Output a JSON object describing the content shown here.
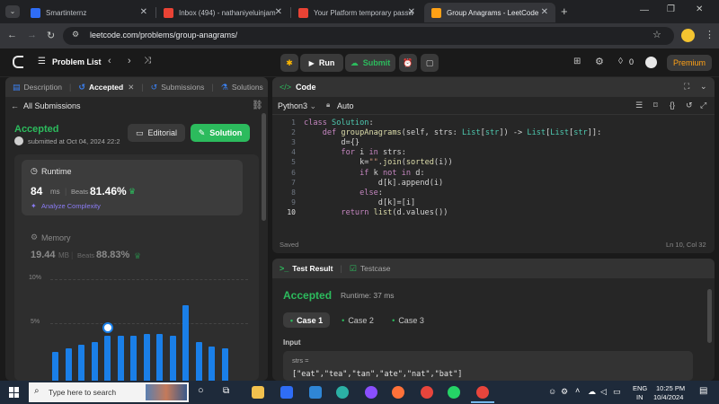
{
  "browser": {
    "tabs": [
      {
        "label": "Smartinternz",
        "fav": "#2f6df6"
      },
      {
        "label": "Inbox (494) - nathaniyeluinjam",
        "fav": "#ea4335"
      },
      {
        "label": "Your Platform temporary passw",
        "fav": "#ea4335"
      },
      {
        "label": "Group Anagrams - LeetCode",
        "fav": "#ffa116"
      }
    ],
    "new_tab": "+",
    "url": "leetcode.com/problems/group-anagrams/"
  },
  "lc": {
    "problem_list": "Problem List",
    "run": "Run",
    "submit": "Submit",
    "counter": "0",
    "premium": "Premium"
  },
  "left": {
    "tabs": [
      "Description",
      "Accepted",
      "Submissions",
      "Solutions"
    ],
    "all_submissions": "All Submissions",
    "status": "Accepted",
    "submitted": "submitted at Oct 04, 2024 22:2",
    "editorial": "Editorial",
    "solution": "Solution",
    "runtime": {
      "title": "Runtime",
      "value": "84",
      "unit": "ms",
      "beats_label": "Beats",
      "beats_value": "81.46%",
      "analyze": "Analyze Complexity"
    },
    "memory": {
      "title": "Memory",
      "value": "19.44",
      "unit": "MB",
      "beats_label": "Beats",
      "beats_value": "88.83%"
    },
    "chart_labels": {
      "top": "10%",
      "mid": "5%"
    }
  },
  "chart_data": {
    "type": "bar",
    "y_ticks": [
      "10%",
      "5%"
    ],
    "ylim": [
      0,
      10
    ],
    "values": [
      2.8,
      3.2,
      3.5,
      3.8,
      4.4,
      4.4,
      4.4,
      4.6,
      4.6,
      4.4,
      7.4,
      3.8,
      3.4,
      3.2
    ],
    "highlight_index": 4
  },
  "editor": {
    "title": "Code",
    "language": "Python3",
    "auto": "Auto",
    "lines": [
      [
        [
          "kw",
          "class "
        ],
        [
          "ty",
          "Solution"
        ],
        [
          "pl",
          ":"
        ]
      ],
      [
        [
          "pl",
          "    "
        ],
        [
          "kw",
          "def "
        ],
        [
          "fn",
          "groupAnagrams"
        ],
        [
          "pl",
          "(self, strs: "
        ],
        [
          "ty",
          "List"
        ],
        [
          "pl",
          "["
        ],
        [
          "ty",
          "str"
        ],
        [
          "pl",
          "]) -> "
        ],
        [
          "ty",
          "List"
        ],
        [
          "pl",
          "["
        ],
        [
          "ty",
          "List"
        ],
        [
          "pl",
          "["
        ],
        [
          "ty",
          "str"
        ],
        [
          "pl",
          "]]:"
        ]
      ],
      [
        [
          "pl",
          "        d={}"
        ]
      ],
      [
        [
          "pl",
          "        "
        ],
        [
          "kw",
          "for "
        ],
        [
          "pl",
          "i "
        ],
        [
          "kw",
          "in "
        ],
        [
          "pl",
          "strs:"
        ]
      ],
      [
        [
          "pl",
          "            k="
        ],
        [
          "st",
          "\"\""
        ],
        [
          "pl",
          "."
        ],
        [
          "fn",
          "join"
        ],
        [
          "pl",
          "("
        ],
        [
          "fn",
          "sorted"
        ],
        [
          "pl",
          "(i))"
        ]
      ],
      [
        [
          "pl",
          "            "
        ],
        [
          "kw",
          "if "
        ],
        [
          "pl",
          "k "
        ],
        [
          "kw",
          "not in "
        ],
        [
          "pl",
          "d:"
        ]
      ],
      [
        [
          "pl",
          "                d[k].append(i)"
        ]
      ],
      [
        [
          "pl",
          "            "
        ],
        [
          "kw",
          "else"
        ],
        [
          "pl",
          ":"
        ]
      ],
      [
        [
          "pl",
          "                d[k]=[i]"
        ]
      ],
      [
        [
          "pl",
          "        "
        ],
        [
          "kw",
          "return "
        ],
        [
          "fn",
          "list"
        ],
        [
          "pl",
          "(d.values())"
        ]
      ]
    ],
    "saved": "Saved",
    "cursor": "Ln 10, Col 32"
  },
  "result": {
    "tab1": "Test Result",
    "tab2": "Testcase",
    "status": "Accepted",
    "runtime": "Runtime: 37 ms",
    "cases": [
      "Case 1",
      "Case 2",
      "Case 3"
    ],
    "input_label": "Input",
    "strs_label": "strs =",
    "strs_value": "[\"eat\",\"tea\",\"tan\",\"ate\",\"nat\",\"bat\"]"
  },
  "taskbar": {
    "search": "Type here to search",
    "lang1": "ENG",
    "lang2": "IN",
    "time": "10:25 PM",
    "date": "10/4/2024"
  }
}
